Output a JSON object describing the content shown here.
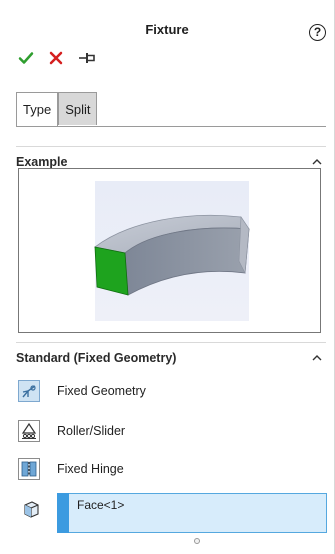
{
  "panel": {
    "title": "Fixture",
    "help_icon": "help-icon",
    "actions": [
      {
        "name": "ok-button",
        "icon": "checkmark-icon",
        "color": "#2f9e2f"
      },
      {
        "name": "cancel-button",
        "icon": "close-icon",
        "color": "#d51f1f"
      },
      {
        "name": "pin-button",
        "icon": "pushpin-icon",
        "color": "#333333"
      }
    ]
  },
  "tabs": [
    {
      "label": "Type",
      "active": true
    },
    {
      "label": "Split",
      "active": false
    }
  ],
  "example": {
    "title": "Example",
    "image": "curved-block-fixed-face-preview"
  },
  "standard": {
    "title": "Standard (Fixed Geometry)",
    "options": [
      {
        "label": "Fixed Geometry",
        "icon": "fixed-geometry-icon",
        "selected": true
      },
      {
        "label": "Roller/Slider",
        "icon": "roller-slider-icon",
        "selected": false
      },
      {
        "label": "Fixed Hinge",
        "icon": "fixed-hinge-icon",
        "selected": false
      }
    ],
    "selection_icon": "face-selection-icon",
    "selection_value": "Face<1>"
  },
  "colors": {
    "accent_blue": "#3c9be0",
    "selection_fill": "#d7ecfb",
    "face_green": "#1ea31e",
    "part_gray": "#8d96a6"
  }
}
